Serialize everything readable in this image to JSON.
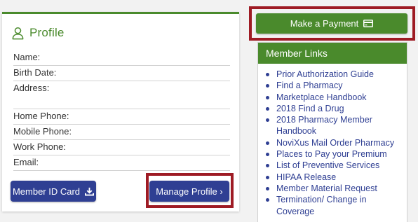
{
  "profile": {
    "title": "Profile",
    "icon": "user-outline-icon",
    "fields": {
      "name": "Name:",
      "birth_date": "Birth Date:",
      "address": "Address:",
      "home_phone": "Home Phone:",
      "mobile_phone": "Mobile Phone:",
      "work_phone": "Work Phone:",
      "email": "Email:"
    },
    "member_id_button": "Member ID Card",
    "member_id_icon": "download-icon",
    "manage_profile_button": "Manage Profile ›"
  },
  "payment": {
    "label": "Make a Payment",
    "icon": "credit-card-icon"
  },
  "member_links": {
    "title": "Member Links",
    "items": [
      "Prior Authorization Guide",
      "Find a Pharmacy",
      "Marketplace Handbook",
      "2018 Find a Drug",
      "2018 Pharmacy Member Handbook",
      "NoviXus Mail Order Pharmacy",
      "Places to Pay your Premium",
      "List of Preventive Services",
      "HIPAA Release",
      "Member Material Request",
      "Termination/ Change in Coverage"
    ]
  },
  "colors": {
    "brand_green": "#4a8a2c",
    "button_blue": "#2f3f93",
    "highlight_red": "#9e1b24"
  }
}
